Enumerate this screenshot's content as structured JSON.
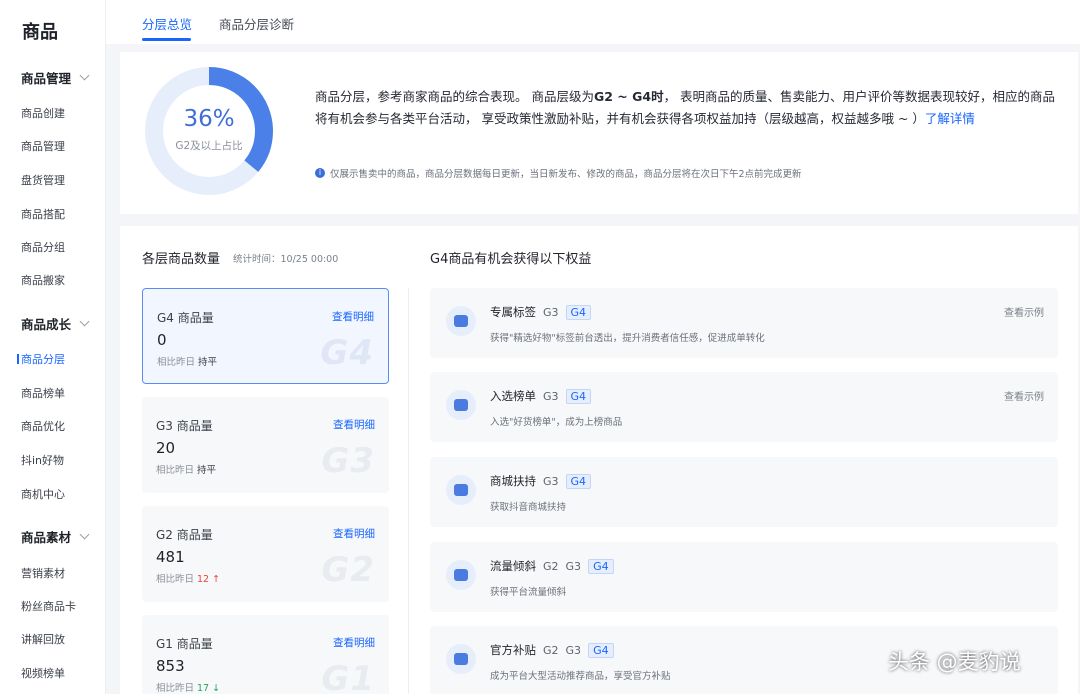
{
  "sidebar": {
    "title": "商品",
    "groups": [
      {
        "label": "商品管理",
        "items": [
          "商品创建",
          "商品管理",
          "盘货管理",
          "商品搭配",
          "商品分组",
          "商品搬家"
        ]
      },
      {
        "label": "商品成长",
        "items": [
          "商品分层",
          "商品榜单",
          "商品优化",
          "抖in好物",
          "商机中心"
        ]
      },
      {
        "label": "商品素材",
        "items": [
          "营销素材",
          "粉丝商品卡",
          "讲解回放",
          "视频榜单"
        ]
      }
    ],
    "active_item": "商品分层"
  },
  "tabs": [
    {
      "label": "分层总览",
      "active": true
    },
    {
      "label": "商品分层诊断",
      "active": false
    }
  ],
  "summary": {
    "percent_value": 36,
    "percent_text": "36%",
    "percent_label": "G2及以上占比",
    "text_part1": "商品分层，参考商家商品的综合表现。 商品层级为",
    "text_bold": "G2 ~ G4时",
    "text_part2": "， 表明商品的质量、售卖能力、用户评价等数据表现较好，相应的商品将有机会参与各类平台活动， 享受政策性激励补贴，并有机会获得各项权益加持（层级越高，权益越多哦 ~ ）",
    "link_text": "了解详情",
    "note": "仅展示售卖中的商品，商品分层数据每日更新，当日新发布、修改的商品，商品分层将在次日下午2点前完成更新"
  },
  "tier_panel": {
    "title": "各层商品数量",
    "stat_time": "统计时间：10/25 00:00",
    "compare_label": "相比昨日",
    "link_label": "查看明细",
    "tiers": [
      {
        "name": "G4 商品量",
        "count": "0",
        "change": "持平",
        "trend": "flat",
        "watermark": "G4",
        "active": true
      },
      {
        "name": "G3 商品量",
        "count": "20",
        "change": "持平",
        "trend": "flat",
        "watermark": "G3",
        "active": false
      },
      {
        "name": "G2 商品量",
        "count": "481",
        "change": "12 ↑",
        "trend": "up",
        "watermark": "G2",
        "active": false
      },
      {
        "name": "G1 商品量",
        "count": "853",
        "change": "17 ↓",
        "trend": "down",
        "watermark": "G1",
        "active": false
      }
    ]
  },
  "benefits": {
    "title": "G4商品有机会获得以下权益",
    "example_label": "查看示例",
    "items": [
      {
        "name": "专属标签",
        "grades": [
          "G3",
          "G4"
        ],
        "desc": "获得\"精选好物\"标签前台透出，提升消费者信任感，促进成单转化",
        "has_example": true,
        "icon": "tag-icon"
      },
      {
        "name": "入选榜单",
        "grades": [
          "G3",
          "G4"
        ],
        "desc": "入选\"好货榜单\"，成为上榜商品",
        "has_example": true,
        "icon": "badge-icon"
      },
      {
        "name": "商城扶持",
        "grades": [
          "G3",
          "G4"
        ],
        "desc": "获取抖音商城扶持",
        "has_example": false,
        "icon": "shop-icon"
      },
      {
        "name": "流量倾斜",
        "grades": [
          "G2",
          "G3",
          "G4"
        ],
        "desc": "获得平台流量倾斜",
        "has_example": false,
        "icon": "traffic-icon"
      },
      {
        "name": "官方补贴",
        "grades": [
          "G2",
          "G3",
          "G4"
        ],
        "desc": "成为平台大型活动推荐商品，享受官方补贴",
        "has_example": false,
        "icon": "subsidy-icon"
      }
    ]
  },
  "watermark_text": "头条 @麦豹说",
  "colors": {
    "accent": "#1966ff",
    "donut_fill": "#4a80e8",
    "donut_track": "#e6eefc",
    "up": "#e8453c",
    "down": "#21a55c"
  }
}
